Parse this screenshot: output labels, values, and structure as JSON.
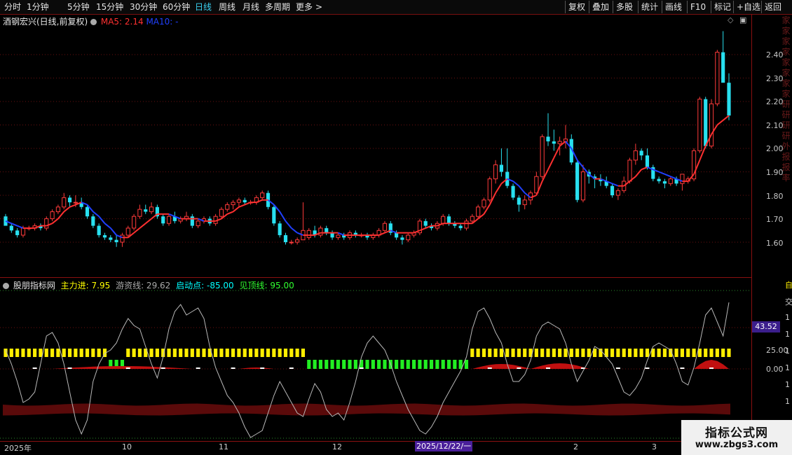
{
  "toolbar": {
    "periods": [
      "分时",
      "1分钟",
      "5分钟",
      "15分钟",
      "30分钟",
      "60分钟",
      "日线",
      "周线",
      "月线",
      "多周期",
      "更多"
    ],
    "active": "日线",
    "more_arrow": ">",
    "right_buttons": [
      "复权",
      "叠加",
      "多股",
      "统计",
      "画线",
      "F10",
      "标记",
      "+自选",
      "返回"
    ]
  },
  "stock": {
    "title": "酒钢宏兴(日线,前复权)",
    "ma5_label": "MA5: 2.14",
    "ma10_label": "MA10: -",
    "ma5_color": "#ff3030",
    "ma10_color": "#2040ff"
  },
  "price_axis": {
    "ticks": [
      "2.40",
      "2.30",
      "2.20",
      "2.10",
      "2.00",
      "1.90",
      "1.80",
      "1.70",
      "1.60"
    ]
  },
  "right_strip_chars": [
    "家",
    "家",
    "家",
    "家",
    "家",
    "家",
    "家",
    "家",
    "研",
    "研",
    "研",
    "研",
    "外",
    "报",
    "报",
    "率"
  ],
  "indicator": {
    "name": "股朋指标网",
    "main_label": "主力进: 7.95",
    "hot_label": "游资线: 29.62",
    "start_label": "启动点: -85.00",
    "top_label": "见顶线: 95.00",
    "name_color": "#e0e0e0",
    "main_color": "#ffff00",
    "hot_color": "#aaaaaa",
    "start_color": "#00ffff",
    "top_color": "#30ff30",
    "axis_ticks": [
      "25.00",
      "0.00"
    ],
    "current_value": "43.52",
    "side_chars": [
      "自",
      "交",
      "1",
      "1",
      "1",
      "1",
      "1",
      "1"
    ]
  },
  "dates": {
    "labels": [
      "2025年",
      "10",
      "11",
      "12",
      "2",
      "3"
    ],
    "cursor": "2025/12/22/一"
  },
  "watermark": {
    "line1": "指标公式网",
    "line2": "www.zbgs3.com"
  },
  "colors": {
    "up": "#ff3a3a",
    "down": "#28e0f0",
    "grid": "#6a1010",
    "yellow_bar": "#ffee00",
    "green_bar": "#22ee22"
  },
  "chart_data": {
    "type": "candlestick",
    "ylim": [
      1.55,
      2.48
    ],
    "candles": [
      [
        1.71,
        1.72,
        1.67,
        1.67
      ],
      [
        1.67,
        1.68,
        1.64,
        1.65
      ],
      [
        1.65,
        1.66,
        1.62,
        1.63
      ],
      [
        1.63,
        1.67,
        1.62,
        1.66
      ],
      [
        1.66,
        1.67,
        1.65,
        1.66
      ],
      [
        1.66,
        1.68,
        1.65,
        1.67
      ],
      [
        1.67,
        1.68,
        1.65,
        1.66
      ],
      [
        1.66,
        1.71,
        1.65,
        1.7
      ],
      [
        1.7,
        1.74,
        1.69,
        1.73
      ],
      [
        1.73,
        1.76,
        1.72,
        1.75
      ],
      [
        1.75,
        1.81,
        1.74,
        1.79
      ],
      [
        1.79,
        1.8,
        1.75,
        1.77
      ],
      [
        1.77,
        1.8,
        1.75,
        1.77
      ],
      [
        1.77,
        1.79,
        1.74,
        1.75
      ],
      [
        1.75,
        1.76,
        1.7,
        1.71
      ],
      [
        1.71,
        1.72,
        1.66,
        1.67
      ],
      [
        1.67,
        1.68,
        1.62,
        1.63
      ],
      [
        1.63,
        1.64,
        1.61,
        1.62
      ],
      [
        1.62,
        1.63,
        1.6,
        1.61
      ],
      [
        1.61,
        1.63,
        1.58,
        1.6
      ],
      [
        1.6,
        1.64,
        1.58,
        1.63
      ],
      [
        1.63,
        1.67,
        1.62,
        1.66
      ],
      [
        1.66,
        1.72,
        1.65,
        1.71
      ],
      [
        1.71,
        1.76,
        1.7,
        1.74
      ],
      [
        1.74,
        1.76,
        1.72,
        1.73
      ],
      [
        1.73,
        1.77,
        1.72,
        1.75
      ],
      [
        1.75,
        1.76,
        1.7,
        1.71
      ],
      [
        1.71,
        1.72,
        1.67,
        1.68
      ],
      [
        1.68,
        1.72,
        1.67,
        1.71
      ],
      [
        1.71,
        1.73,
        1.68,
        1.69
      ],
      [
        1.69,
        1.71,
        1.68,
        1.7
      ],
      [
        1.7,
        1.73,
        1.69,
        1.71
      ],
      [
        1.71,
        1.72,
        1.66,
        1.67
      ],
      [
        1.67,
        1.7,
        1.66,
        1.69
      ],
      [
        1.69,
        1.71,
        1.68,
        1.7
      ],
      [
        1.7,
        1.71,
        1.67,
        1.68
      ],
      [
        1.68,
        1.72,
        1.67,
        1.71
      ],
      [
        1.71,
        1.75,
        1.7,
        1.74
      ],
      [
        1.74,
        1.77,
        1.73,
        1.76
      ],
      [
        1.76,
        1.78,
        1.74,
        1.77
      ],
      [
        1.77,
        1.79,
        1.75,
        1.78
      ],
      [
        1.78,
        1.79,
        1.76,
        1.77
      ],
      [
        1.77,
        1.78,
        1.76,
        1.77
      ],
      [
        1.77,
        1.8,
        1.76,
        1.79
      ],
      [
        1.79,
        1.82,
        1.78,
        1.81
      ],
      [
        1.81,
        1.82,
        1.74,
        1.75
      ],
      [
        1.75,
        1.76,
        1.67,
        1.68
      ],
      [
        1.68,
        1.69,
        1.62,
        1.63
      ],
      [
        1.63,
        1.64,
        1.59,
        1.6
      ],
      [
        1.6,
        1.61,
        1.59,
        1.6
      ],
      [
        1.6,
        1.62,
        1.59,
        1.61
      ],
      [
        1.61,
        1.77,
        1.61,
        1.65
      ],
      [
        1.62,
        1.66,
        1.61,
        1.65
      ],
      [
        1.65,
        1.67,
        1.62,
        1.63
      ],
      [
        1.63,
        1.67,
        1.62,
        1.66
      ],
      [
        1.66,
        1.67,
        1.63,
        1.64
      ],
      [
        1.64,
        1.65,
        1.61,
        1.62
      ],
      [
        1.62,
        1.64,
        1.61,
        1.63
      ],
      [
        1.63,
        1.64,
        1.61,
        1.62
      ],
      [
        1.62,
        1.65,
        1.61,
        1.64
      ],
      [
        1.64,
        1.65,
        1.62,
        1.63
      ],
      [
        1.63,
        1.64,
        1.62,
        1.63
      ],
      [
        1.63,
        1.64,
        1.61,
        1.62
      ],
      [
        1.62,
        1.64,
        1.61,
        1.63
      ],
      [
        1.63,
        1.66,
        1.62,
        1.65
      ],
      [
        1.65,
        1.69,
        1.64,
        1.68
      ],
      [
        1.68,
        1.69,
        1.63,
        1.64
      ],
      [
        1.64,
        1.65,
        1.61,
        1.62
      ],
      [
        1.62,
        1.63,
        1.59,
        1.61
      ],
      [
        1.61,
        1.64,
        1.6,
        1.63
      ],
      [
        1.63,
        1.65,
        1.62,
        1.64
      ],
      [
        1.64,
        1.7,
        1.63,
        1.69
      ],
      [
        1.69,
        1.7,
        1.66,
        1.67
      ],
      [
        1.67,
        1.68,
        1.65,
        1.66
      ],
      [
        1.66,
        1.69,
        1.65,
        1.68
      ],
      [
        1.68,
        1.72,
        1.67,
        1.71
      ],
      [
        1.71,
        1.72,
        1.67,
        1.68
      ],
      [
        1.68,
        1.69,
        1.66,
        1.67
      ],
      [
        1.67,
        1.68,
        1.65,
        1.66
      ],
      [
        1.66,
        1.7,
        1.65,
        1.69
      ],
      [
        1.69,
        1.72,
        1.68,
        1.71
      ],
      [
        1.71,
        1.76,
        1.7,
        1.75
      ],
      [
        1.75,
        1.79,
        1.74,
        1.78
      ],
      [
        1.78,
        1.88,
        1.77,
        1.87
      ],
      [
        1.87,
        1.95,
        1.85,
        1.93
      ],
      [
        1.93,
        2.0,
        1.88,
        1.9
      ],
      [
        1.9,
        2.0,
        1.83,
        1.84
      ],
      [
        1.84,
        1.85,
        1.78,
        1.79
      ],
      [
        1.79,
        1.8,
        1.73,
        1.76
      ],
      [
        1.76,
        1.8,
        1.74,
        1.78
      ],
      [
        1.78,
        1.82,
        1.76,
        1.81
      ],
      [
        1.81,
        1.9,
        1.8,
        1.88
      ],
      [
        1.88,
        2.06,
        1.87,
        2.05
      ],
      [
        2.05,
        2.15,
        2.01,
        2.03
      ],
      [
        2.03,
        2.08,
        1.99,
        2.02
      ],
      [
        2.02,
        2.05,
        1.97,
        2.03
      ],
      [
        2.03,
        2.1,
        2.0,
        2.04
      ],
      [
        2.04,
        2.06,
        1.93,
        1.94
      ],
      [
        1.94,
        1.95,
        1.77,
        1.78
      ],
      [
        1.78,
        1.93,
        1.77,
        1.9
      ],
      [
        1.9,
        1.91,
        1.85,
        1.88
      ],
      [
        1.88,
        1.89,
        1.83,
        1.87
      ],
      [
        1.87,
        1.89,
        1.84,
        1.86
      ],
      [
        1.86,
        1.88,
        1.83,
        1.84
      ],
      [
        1.84,
        1.85,
        1.79,
        1.8
      ],
      [
        1.8,
        1.83,
        1.78,
        1.82
      ],
      [
        1.82,
        1.88,
        1.81,
        1.86
      ],
      [
        1.86,
        1.96,
        1.85,
        1.95
      ],
      [
        1.95,
        2.02,
        1.93,
        1.99
      ],
      [
        1.99,
        2.0,
        1.95,
        1.97
      ],
      [
        1.97,
        2.0,
        1.91,
        1.92
      ],
      [
        1.92,
        1.93,
        1.86,
        1.87
      ],
      [
        1.87,
        1.88,
        1.85,
        1.86
      ],
      [
        1.86,
        1.87,
        1.83,
        1.85
      ],
      [
        1.85,
        1.88,
        1.84,
        1.87
      ],
      [
        1.87,
        1.88,
        1.84,
        1.85
      ],
      [
        1.85,
        1.86,
        1.82,
        1.89
      ],
      [
        1.86,
        1.88,
        1.85,
        1.87
      ],
      [
        1.87,
        2.0,
        1.86,
        1.99
      ],
      [
        1.99,
        2.22,
        1.98,
        2.21
      ],
      [
        2.21,
        2.22,
        2.0,
        2.01
      ],
      [
        2.01,
        2.21,
        2.0,
        2.19
      ],
      [
        2.19,
        2.42,
        2.18,
        2.41
      ],
      [
        2.41,
        2.5,
        2.3,
        2.28
      ],
      [
        2.28,
        2.32,
        2.12,
        2.14
      ]
    ],
    "ma5": [
      1.69,
      1.68,
      1.67,
      1.66,
      1.66,
      1.66,
      1.67,
      1.67,
      1.68,
      1.7,
      1.73,
      1.75,
      1.76,
      1.77,
      1.76,
      1.73,
      1.71,
      1.68,
      1.66,
      1.63,
      1.62,
      1.62,
      1.64,
      1.66,
      1.68,
      1.7,
      1.72,
      1.72,
      1.72,
      1.71,
      1.7,
      1.7,
      1.7,
      1.7,
      1.69,
      1.69,
      1.69,
      1.7,
      1.72,
      1.73,
      1.75,
      1.76,
      1.77,
      1.77,
      1.78,
      1.78,
      1.76,
      1.73,
      1.69,
      1.66,
      1.64,
      1.63,
      1.63,
      1.63,
      1.64,
      1.64,
      1.64,
      1.64,
      1.63,
      1.63,
      1.63,
      1.63,
      1.63,
      1.63,
      1.63,
      1.64,
      1.65,
      1.64,
      1.64,
      1.64,
      1.64,
      1.65,
      1.66,
      1.67,
      1.67,
      1.68,
      1.68,
      1.68,
      1.68,
      1.68,
      1.68,
      1.7,
      1.72,
      1.76,
      1.81,
      1.85,
      1.87,
      1.86,
      1.84,
      1.81,
      1.79,
      1.8,
      1.86,
      1.91,
      1.96,
      2.01,
      2.03,
      2.0,
      1.95,
      1.92,
      1.89,
      1.87,
      1.87,
      1.86,
      1.85,
      1.84,
      1.84,
      1.86,
      1.88,
      1.91,
      1.92,
      1.91,
      1.9,
      1.89,
      1.88,
      1.87,
      1.86,
      1.86,
      1.89,
      1.95,
      2.01,
      2.06,
      2.1,
      2.12,
      2.14
    ]
  }
}
